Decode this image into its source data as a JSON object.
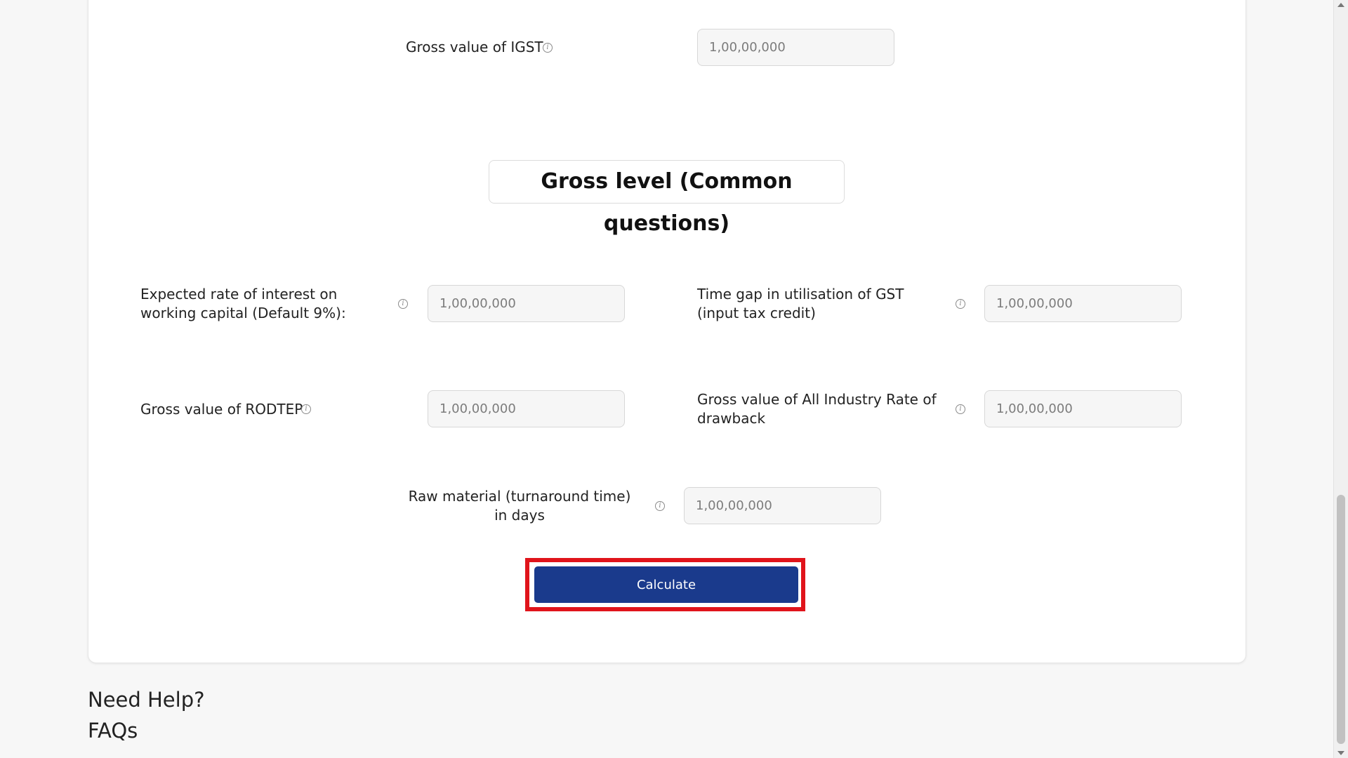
{
  "top_field": {
    "label": "Gross value of IGST",
    "placeholder": "1,00,00,000"
  },
  "section_title": "Gross level (Common questions)",
  "fields": [
    {
      "label": "Expected rate of interest on working capital (Default 9%):",
      "placeholder": "1,00,00,000"
    },
    {
      "label": "Time gap in utilisation of GST (input tax credit)",
      "placeholder": "1,00,00,000"
    },
    {
      "label": "Gross value of RODTEP",
      "placeholder": "1,00,00,000"
    },
    {
      "label": "Gross value of All Industry Rate of drawback",
      "placeholder": "1,00,00,000"
    },
    {
      "label": "Raw material (turnaround time) in days",
      "placeholder": "1,00,00,000"
    }
  ],
  "info_glyph": "i",
  "calculate_label": "Calculate",
  "help": {
    "need_help": "Need Help?",
    "faqs": "FAQs"
  },
  "colors": {
    "button": "#1a3a8c",
    "highlight": "#e0141b"
  }
}
